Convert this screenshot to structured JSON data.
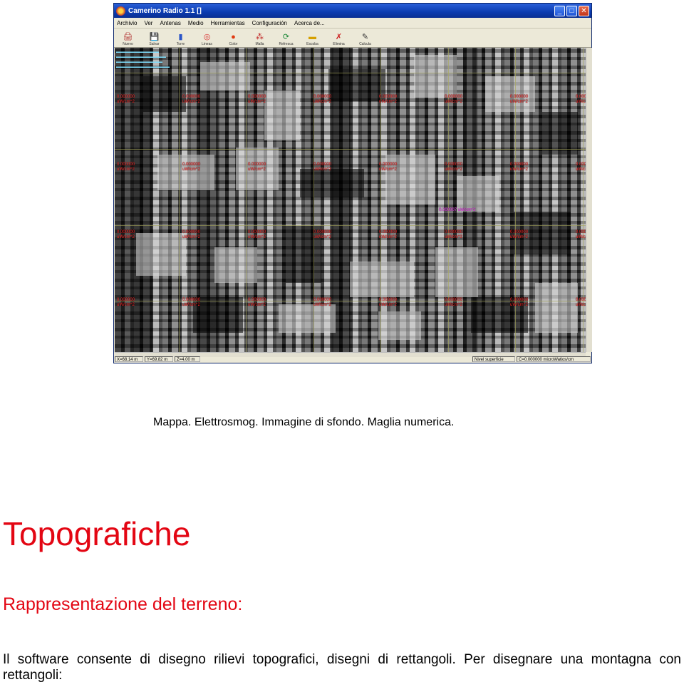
{
  "window": {
    "title": "Camerino Radio 1.1 []",
    "controls": [
      "_",
      "□",
      "✕"
    ],
    "menu": [
      "Archivio",
      "Ver",
      "Antenas",
      "Medio",
      "Herramientas",
      "Configuración",
      "Acerca de..."
    ],
    "toolbar": [
      {
        "label": "Nuevo",
        "icon": "printer-icon",
        "glyph": "🖨",
        "color": "#b03030"
      },
      {
        "label": "Salvar",
        "icon": "save-disk-icon",
        "glyph": "💾",
        "color": "#1f3f9a"
      },
      {
        "label": "Torre",
        "icon": "tower-icon",
        "glyph": "▮",
        "color": "#2a55c8"
      },
      {
        "label": "Lineas",
        "icon": "lines-icon",
        "glyph": "◎",
        "color": "#d83030"
      },
      {
        "label": "Color",
        "icon": "color-icon",
        "glyph": "●",
        "color": "#e03a10"
      },
      {
        "label": "Malla",
        "icon": "grid-icon",
        "glyph": "⁂",
        "color": "#c02020"
      },
      {
        "label": "Refresca",
        "icon": "refresh-icon",
        "glyph": "⟳",
        "color": "#1f8a3a"
      },
      {
        "label": "Escoba",
        "icon": "broom-icon",
        "glyph": "▬",
        "color": "#d6a000"
      },
      {
        "label": "Elimina",
        "icon": "delete-icon",
        "glyph": "✗",
        "color": "#cc2020"
      },
      {
        "label": "Calcula",
        "icon": "calculate-icon",
        "glyph": "✎",
        "color": "#333333"
      }
    ],
    "status": [
      "X=68.14 m",
      "Y=69.82 m",
      "Z=4.00 m",
      "Nivel superficie",
      "C=0.000000 microWatios/cm"
    ]
  },
  "map": {
    "readouts": [
      {
        "v": "0.000000",
        "u": "uW/cm^2"
      },
      {
        "v": "0.000000",
        "u": "uW/cm^2"
      },
      {
        "v": "0.000000",
        "u": "uW/cm^2"
      },
      {
        "v": "0.000000",
        "u": "uW/cm^2"
      },
      {
        "v": "0.000000",
        "u": "uW/cm^2"
      },
      {
        "v": "0.000000",
        "u": "uW/cm^2"
      },
      {
        "v": "0.000000",
        "u": "uW/cm^2"
      },
      {
        "v": "0.000000",
        "u": "uW/cm^2"
      },
      {
        "v": "0.000000",
        "u": "uW/cm^2"
      },
      {
        "v": "0.000000",
        "u": "uW/cm^2"
      },
      {
        "v": "0.000000",
        "u": "uW/cm^2"
      },
      {
        "v": "0.000000",
        "u": "uW/cm^2"
      },
      {
        "v": "0.000000",
        "u": "uW/cm^2"
      },
      {
        "v": "0.000000",
        "u": "uW/cm^2"
      },
      {
        "v": "0.000000",
        "u": "uW/cm^2"
      },
      {
        "v": "0.000000",
        "u": "uW/cm^2"
      },
      {
        "v": "0.000000",
        "u": "uW/cm^2"
      },
      {
        "v": "0.000000",
        "u": "uW/cm^2"
      },
      {
        "v": "0.000000",
        "u": "uW/cm^2"
      },
      {
        "v": "0.000000",
        "u": "uW/cm^2"
      },
      {
        "v": "0.000000",
        "u": "uW/cm^2"
      },
      {
        "v": "0.000000",
        "u": "uW/cm^2"
      },
      {
        "v": "0.000000",
        "u": "uW/cm^2"
      },
      {
        "v": "0.000000",
        "u": "uW/cm^2"
      },
      {
        "v": "0.000000",
        "u": "uW/cm^2"
      },
      {
        "v": "0.000000",
        "u": "uW/cm^2"
      },
      {
        "v": "0.000000",
        "u": "uW/cm^2"
      },
      {
        "v": "0.000000",
        "u": "uW/cm^2"
      },
      {
        "v": "0.000000",
        "u": "uW/cm^2"
      },
      {
        "v": "0.000000",
        "u": "uW/cm^2"
      },
      {
        "v": "0.000000",
        "u": "uW/cm^2"
      },
      {
        "v": "0.000000",
        "u": "uW/cm^2"
      },
      {
        "v": "0.000000",
        "u": "uW/cm^2"
      },
      {
        "v": "0.000000",
        "u": "uW/cm^2"
      },
      {
        "v": "0.000000",
        "u": "uW/cm^2"
      },
      {
        "v": "0.000000",
        "u": "uW/cm^2"
      }
    ],
    "highlight_readout": "0.000007 uW/cm^2",
    "colors": {
      "readout": "#ff2b2b",
      "highlight": "#ff3cff"
    }
  },
  "caption": "Mappa. Elettrosmog. Immagine di sfondo. Maglia numerica.",
  "heading": "Topografiche",
  "subheading": "Rappresentazione del terreno:",
  "paragraph": "Il software consente di disegno rilievi topografici, disegni di rettangoli. Per disegnare una montagna con rettangoli:",
  "colors": {
    "heading": "#e30613",
    "text": "#000000"
  }
}
